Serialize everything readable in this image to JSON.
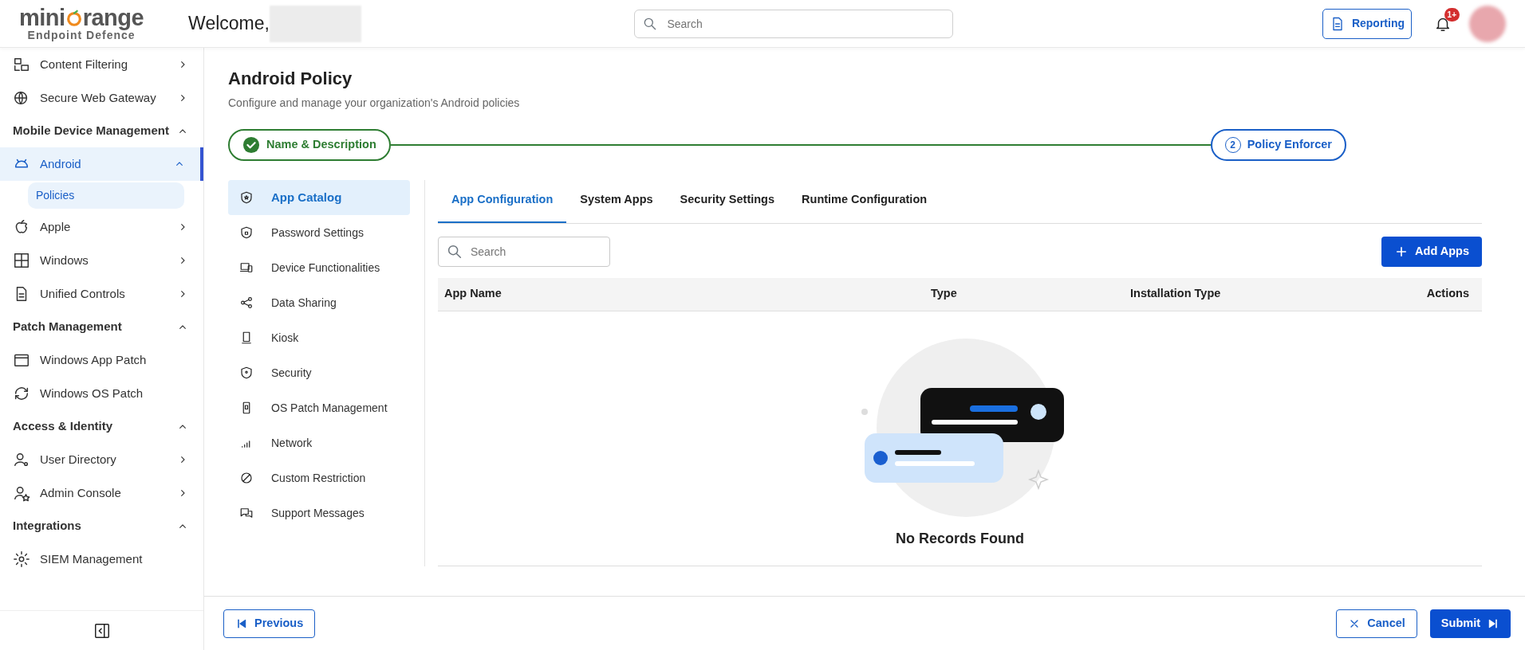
{
  "header": {
    "logo": {
      "brand_start": "mini",
      "brand_end": "range",
      "subtitle": "Endpoint Defence"
    },
    "welcome": "Welcome,",
    "search": {
      "placeholder": "Search"
    },
    "reporting_button": "Reporting",
    "notifications_badge": "1+"
  },
  "sidebar": {
    "items": [
      {
        "kind": "item",
        "label": "Content Filtering",
        "expanded": false
      },
      {
        "kind": "item",
        "label": "Secure Web Gateway",
        "expanded": false
      },
      {
        "kind": "section",
        "label": "Mobile Device Management",
        "expanded": true
      },
      {
        "kind": "item",
        "label": "Android",
        "expanded": true,
        "selected": true,
        "children": [
          {
            "label": "Policies",
            "selected": true
          }
        ]
      },
      {
        "kind": "item",
        "label": "Apple",
        "expanded": false,
        "selected": false
      },
      {
        "kind": "item",
        "label": "Windows",
        "expanded": false,
        "selected": false
      },
      {
        "kind": "item",
        "label": "Unified Controls",
        "expanded": false,
        "selected": false
      },
      {
        "kind": "section",
        "label": "Patch Management",
        "expanded": true
      },
      {
        "kind": "leaf",
        "label": "Windows App Patch",
        "selected": false
      },
      {
        "kind": "leaf",
        "label": "Windows OS Patch",
        "selected": false
      },
      {
        "kind": "section",
        "label": "Access & Identity",
        "expanded": true
      },
      {
        "kind": "item",
        "label": "User Directory",
        "expanded": false,
        "selected": false
      },
      {
        "kind": "item",
        "label": "Admin Console",
        "expanded": false,
        "selected": false
      },
      {
        "kind": "section",
        "label": "Integrations",
        "expanded": true
      },
      {
        "kind": "leaf",
        "label": "SIEM Management",
        "selected": false
      }
    ]
  },
  "page": {
    "title": "Android Policy",
    "subtitle": "Configure and manage your organization's Android policies",
    "steps": [
      {
        "label": "Name & Description",
        "done": true
      },
      {
        "number": "2",
        "label": "Policy Enforcer",
        "done": false
      }
    ],
    "policy_menu": [
      {
        "label": "App Catalog",
        "selected": true
      },
      {
        "label": "Password Settings",
        "selected": false
      },
      {
        "label": "Device Functionalities",
        "selected": false
      },
      {
        "label": "Data Sharing",
        "selected": false
      },
      {
        "label": "Kiosk",
        "selected": false
      },
      {
        "label": "Security",
        "selected": false
      },
      {
        "label": "OS Patch Management",
        "selected": false
      },
      {
        "label": "Network",
        "selected": false
      },
      {
        "label": "Custom Restriction",
        "selected": false
      },
      {
        "label": "Support Messages",
        "selected": false
      }
    ],
    "tabs": [
      {
        "label": "App Configuration",
        "selected": true
      },
      {
        "label": "System Apps",
        "selected": false
      },
      {
        "label": "Security Settings",
        "selected": false
      },
      {
        "label": "Runtime Configuration",
        "selected": false
      }
    ],
    "search": {
      "placeholder": "Search"
    },
    "add_button": "Add Apps",
    "table": {
      "columns": [
        "App Name",
        "Type",
        "Installation Type",
        "Actions"
      ],
      "empty_message": "No Records Found"
    }
  },
  "footer": {
    "previous_button": "Previous",
    "cancel_button": "Cancel",
    "submit_button": "Submit"
  }
}
